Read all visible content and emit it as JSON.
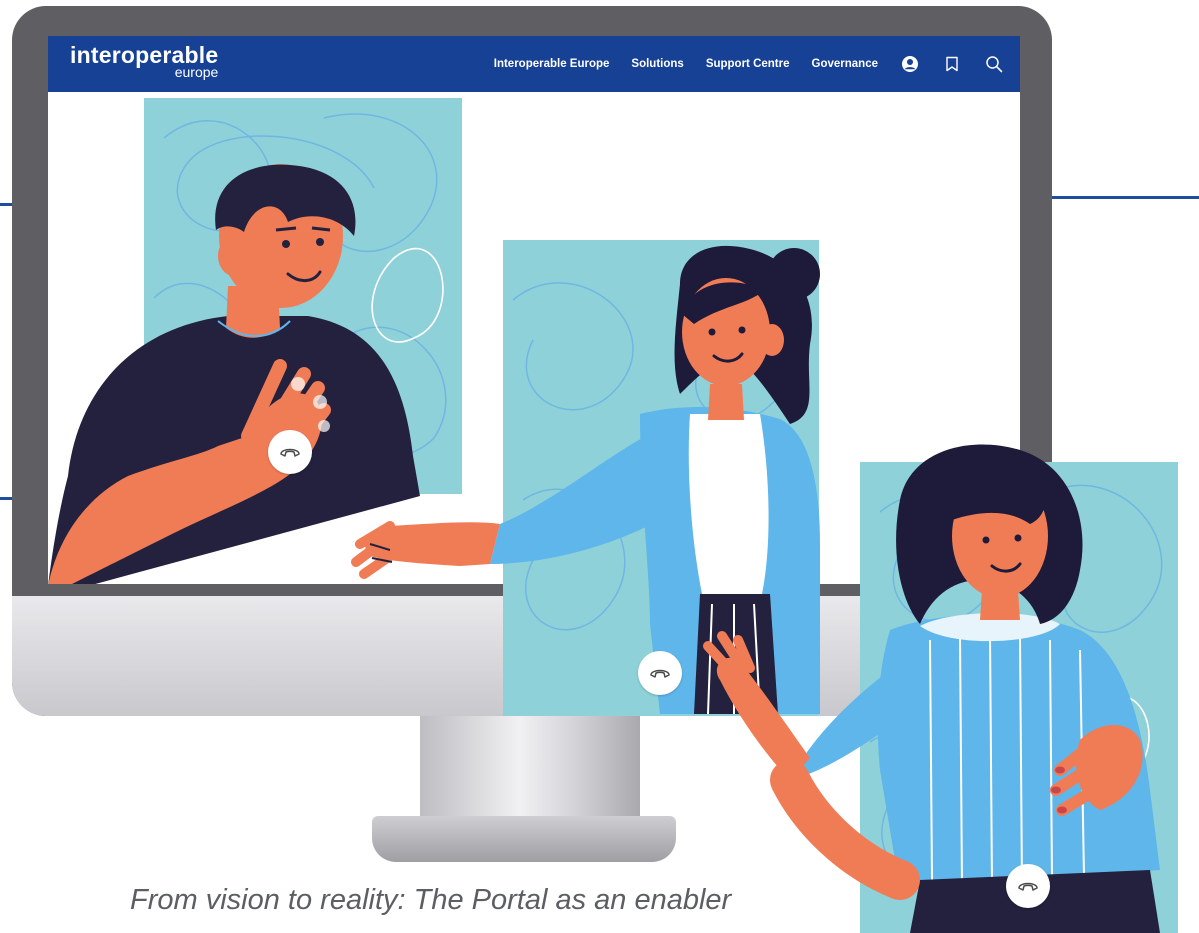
{
  "brand": {
    "name": "interoperable",
    "sub": "europe"
  },
  "nav": {
    "items": [
      {
        "label": "Interoperable Europe"
      },
      {
        "label": "Solutions"
      },
      {
        "label": "Support Centre"
      },
      {
        "label": "Governance"
      }
    ],
    "icons": [
      "user-icon",
      "bookmark-icon",
      "search-icon"
    ]
  },
  "caption": "From vision to reality: The Portal as an enabler",
  "colors": {
    "navbar": "#164194",
    "tile": "#8fd1d8",
    "skin": "#f07c56",
    "hair": "#1d1a3a",
    "jacket": "#5fb6ea",
    "shirt_dark": "#23213d",
    "monitor": "#5f5f63",
    "caption": "#5b5e63"
  },
  "call_icon": "phone-hangup-icon"
}
